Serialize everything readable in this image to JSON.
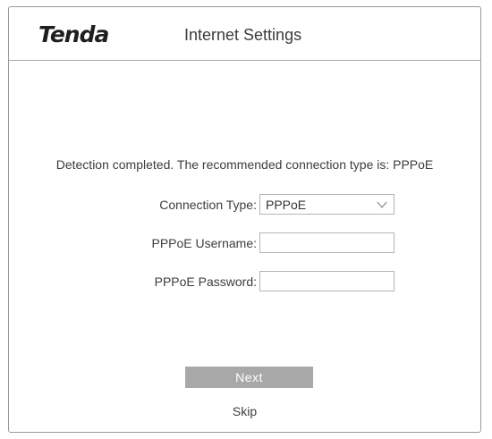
{
  "header": {
    "logo_text": "Tenda",
    "title": "Internet Settings"
  },
  "main": {
    "detection_message": "Detection completed. The recommended connection type is: PPPoE",
    "connection_type": {
      "label": "Connection Type:",
      "selected_value": "PPPoE"
    },
    "username": {
      "label": "PPPoE Username:",
      "value": ""
    },
    "password": {
      "label": "PPPoE Password:",
      "value": ""
    },
    "next_label": "Next",
    "skip_label": "Skip"
  },
  "icons": {
    "dropdown": "chevron-down-icon"
  },
  "colors": {
    "next_button_bg": "#a8a8a8",
    "border": "#9a9a9a"
  }
}
